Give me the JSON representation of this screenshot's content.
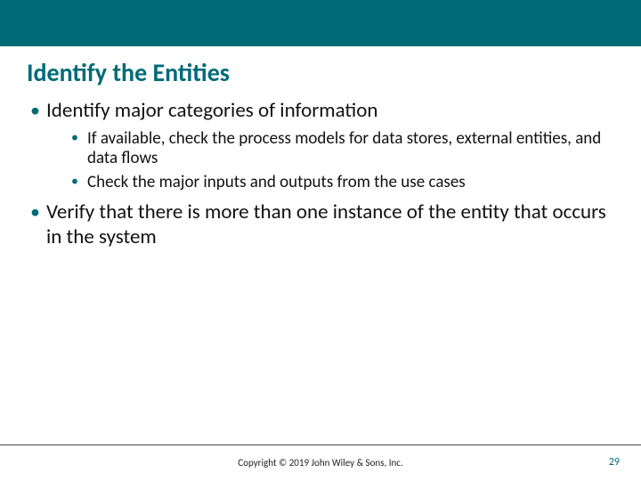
{
  "title": "Identify the Entities",
  "bullets": {
    "b1": "Identify major categories of information",
    "b1_sub1": "If available, check the process models for data stores, external entities, and data flows",
    "b1_sub2": "Check the major inputs and outputs from the use cases",
    "b2": "Verify that there is more than one instance of the entity that occurs in the system"
  },
  "footer": {
    "copyright": "Copyright © 2019 John Wiley & Sons, Inc.",
    "page": "29"
  }
}
